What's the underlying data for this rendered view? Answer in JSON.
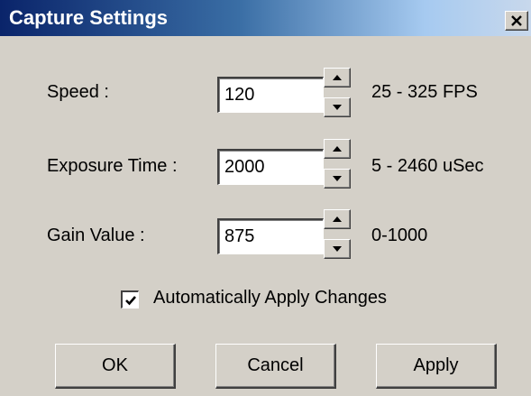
{
  "window": {
    "title": "Capture Settings"
  },
  "settings": [
    {
      "label": "Speed :",
      "value": "120",
      "range": "25 - 325 FPS"
    },
    {
      "label": "Exposure Time :",
      "value": "2000",
      "range": "5 - 2460 uSec"
    },
    {
      "label": "Gain Value :",
      "value": "875",
      "range": "0-1000"
    }
  ],
  "auto_apply": {
    "label": "Automatically Apply Changes",
    "checked": true
  },
  "buttons": {
    "ok": "OK",
    "cancel": "Cancel",
    "apply": "Apply"
  },
  "colors": {
    "titlebar_start": "#0a246a",
    "titlebar_end": "#c8d8ec",
    "face": "#d4d0c8"
  }
}
